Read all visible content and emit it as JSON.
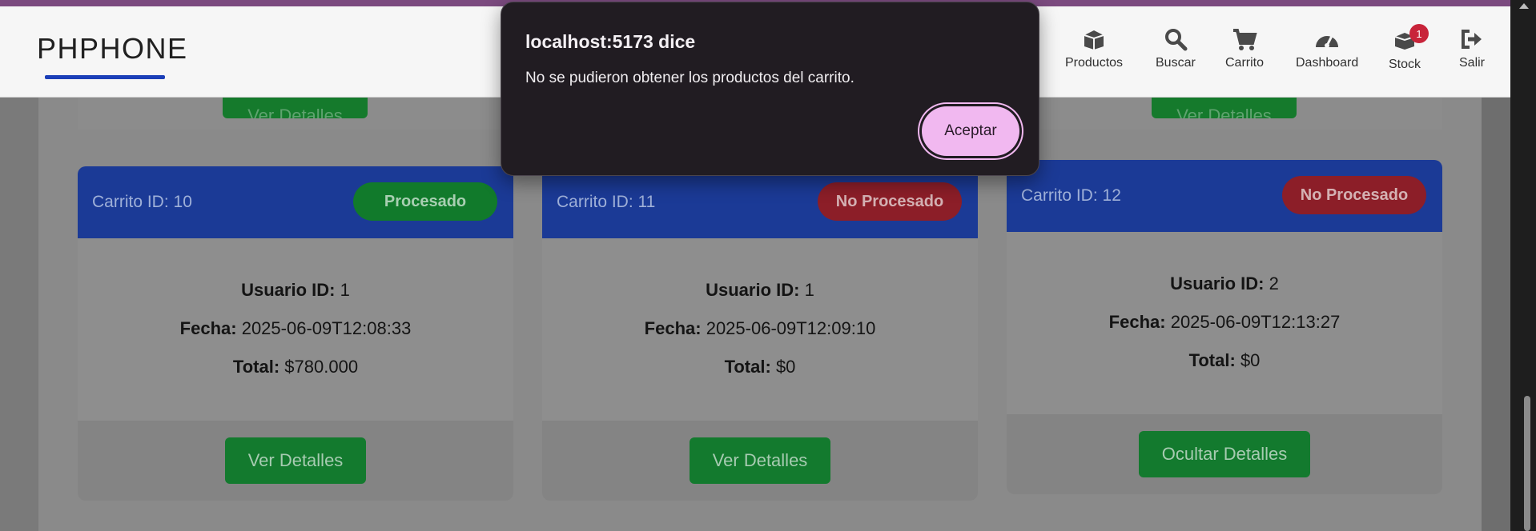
{
  "navbar": {
    "brand": "PHPHONE",
    "items": [
      {
        "label": "Productos",
        "icon": "box-icon"
      },
      {
        "label": "Buscar",
        "icon": "search-icon"
      },
      {
        "label": "Carrito",
        "icon": "cart-icon"
      },
      {
        "label": "Dashboard",
        "icon": "dashboard-icon"
      },
      {
        "label": "Stock",
        "icon": "stock-icon",
        "badge": "1"
      },
      {
        "label": "Salir",
        "icon": "logout-icon"
      }
    ]
  },
  "previous_buttons": [
    "Ver Detalles",
    "Ver Detalles"
  ],
  "cards": [
    {
      "title": "Carrito ID: 10",
      "status": "Procesado",
      "status_color": "green",
      "user_label": "Usuario ID:",
      "user_value": "1",
      "date_label": "Fecha:",
      "date_value": "2025-06-09T12:08:33",
      "total_label": "Total:",
      "total_value": "$780.000",
      "button": "Ver Detalles"
    },
    {
      "title": "Carrito ID: 11",
      "status": "No Procesado",
      "status_color": "red",
      "user_label": "Usuario ID:",
      "user_value": "1",
      "date_label": "Fecha:",
      "date_value": "2025-06-09T12:09:10",
      "total_label": "Total:",
      "total_value": "$0",
      "button": "Ver Detalles"
    },
    {
      "title": "Carrito ID: 12",
      "status": "No Procesado",
      "status_color": "red",
      "user_label": "Usuario ID:",
      "user_value": "2",
      "date_label": "Fecha:",
      "date_value": "2025-06-09T12:13:27",
      "total_label": "Total:",
      "total_value": "$0",
      "button": "Ocultar Detalles"
    }
  ],
  "dialog": {
    "title": "localhost:5173 dice",
    "message": "No se pudieron obtener los productos del carrito.",
    "accept": "Aceptar"
  },
  "colors": {
    "accent": "#1b3fb8",
    "success": "#0f9b35",
    "danger": "#b3252f",
    "dialog_button": "#f1b8f0"
  }
}
